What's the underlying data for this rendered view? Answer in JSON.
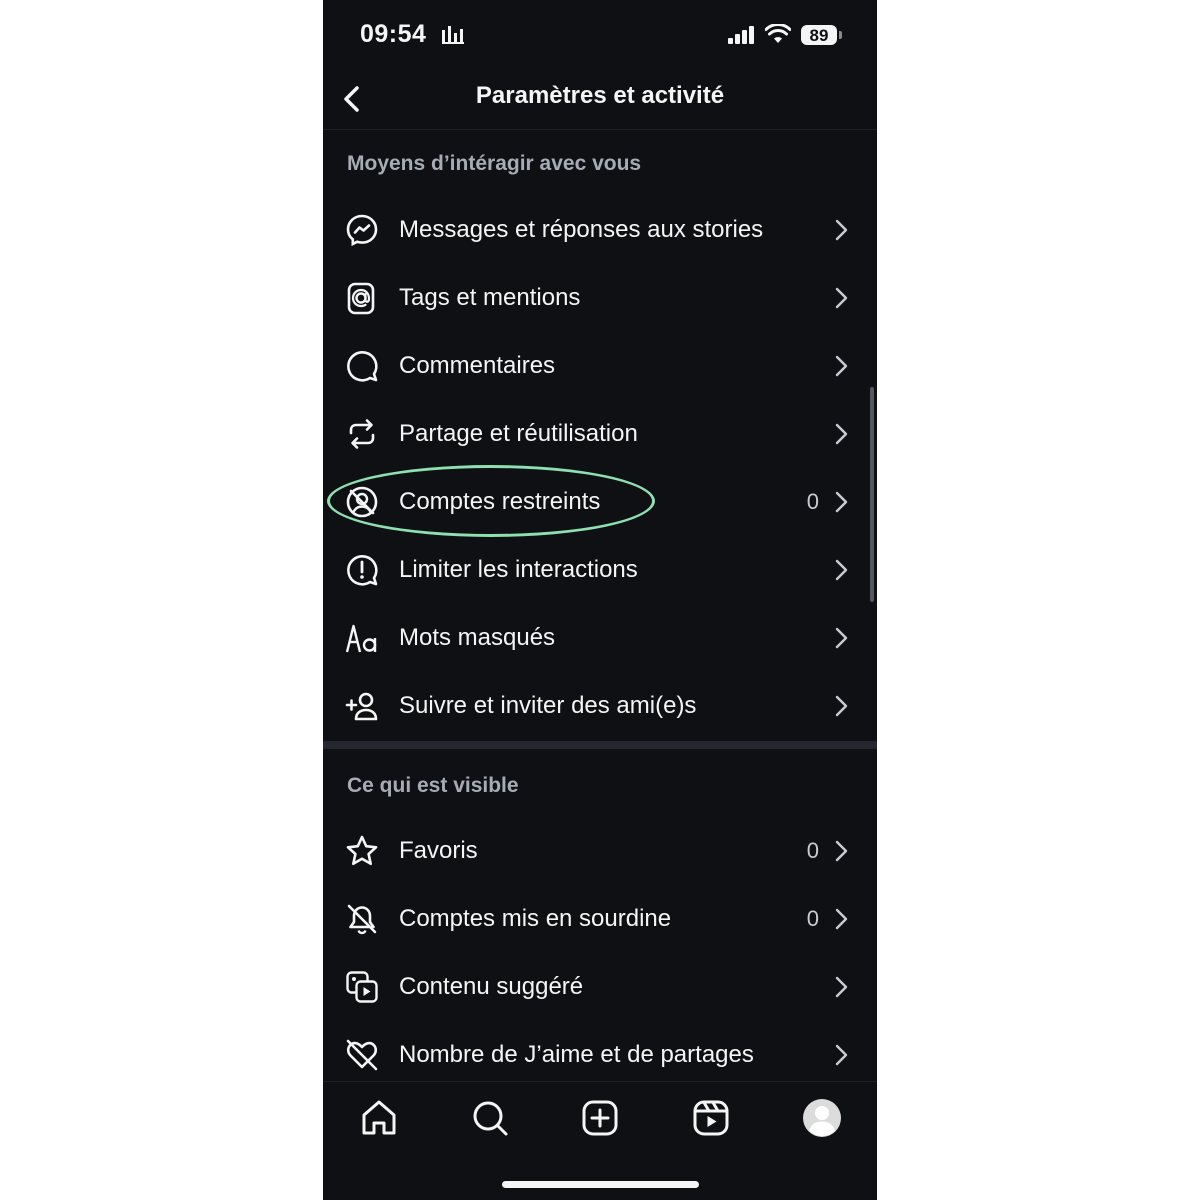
{
  "status_bar": {
    "time": "09:54",
    "battery": "89"
  },
  "header": {
    "title": "Paramètres et activité"
  },
  "sections": [
    {
      "title": "Moyens d’intéragir avec vous",
      "items": [
        {
          "label": "Messages et réponses aux stories",
          "icon": "messenger-icon",
          "count": ""
        },
        {
          "label": "Tags et mentions",
          "icon": "at-sign-icon",
          "count": ""
        },
        {
          "label": "Commentaires",
          "icon": "comment-icon",
          "count": ""
        },
        {
          "label": "Partage et réutilisation",
          "icon": "repost-icon",
          "count": ""
        },
        {
          "label": "Comptes restreints",
          "icon": "restricted-account-icon",
          "count": "0",
          "highlighted": true
        },
        {
          "label": "Limiter les interactions",
          "icon": "alert-bubble-icon",
          "count": ""
        },
        {
          "label": "Mots masqués",
          "icon": "text-aa-icon",
          "count": ""
        },
        {
          "label": "Suivre et inviter des ami(e)s",
          "icon": "add-person-icon",
          "count": ""
        }
      ]
    },
    {
      "title": "Ce qui est visible",
      "items": [
        {
          "label": "Favoris",
          "icon": "star-icon",
          "count": "0"
        },
        {
          "label": "Comptes mis en sourdine",
          "icon": "muted-bell-icon",
          "count": "0"
        },
        {
          "label": "Contenu suggéré",
          "icon": "suggested-content-icon",
          "count": ""
        },
        {
          "label": "Nombre de J’aime et de partages",
          "icon": "hidden-likes-icon",
          "count": ""
        }
      ]
    }
  ],
  "tab_bar": {
    "tabs": [
      "home-icon",
      "search-icon",
      "create-icon",
      "reels-icon",
      "profile-avatar"
    ]
  },
  "colors": {
    "background": "#0e1014",
    "text": "#f5f5f5",
    "section_title": "#a7acb4",
    "highlight": "#8fe0b0"
  }
}
